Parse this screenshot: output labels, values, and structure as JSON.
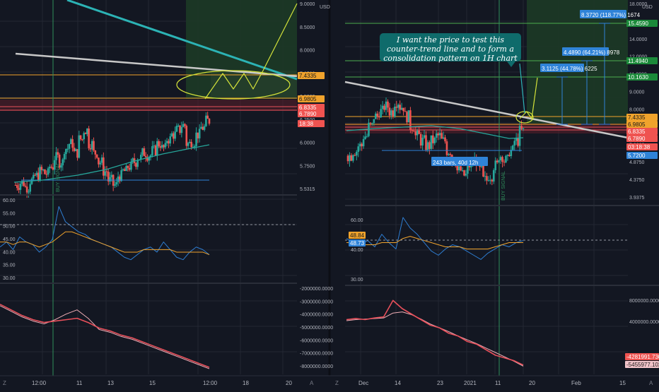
{
  "colors": {
    "bg": "#131722",
    "grid": "#232733",
    "axis_text": "#b2b5be",
    "separator": "#2a2e39",
    "up": "#26a69a",
    "down": "#ef5350",
    "orange": "#f0a32c",
    "green_line": "#4caf50",
    "trend_grey": "#c8c8c8",
    "teal_trend": "#2cb3b5",
    "yellow": "#d4e33a",
    "rsi_blue": "#2e7dd1",
    "ma": "#f0a32c",
    "red_line": "#e8505b",
    "pink": "#f1aeb6",
    "label_blue": "#2f83d8",
    "label_green_bg": "#1b8a3a"
  },
  "left": {
    "price_axis": {
      "ticks": [
        "9.0000",
        "8.5000",
        "8.0000",
        "7.2500",
        "6.5000",
        "6.2500",
        "6.0000",
        "5.7500",
        "5.5315"
      ],
      "currency": "USD"
    },
    "price_labels": [
      {
        "text": "7.4335",
        "style": "orange"
      },
      {
        "text": "6.9805",
        "style": "orange"
      },
      {
        "text": "6.8335",
        "style": "red"
      },
      {
        "text": "6.7890",
        "style": "red"
      },
      {
        "text": "18:38",
        "style": "red"
      }
    ],
    "rsi_axis": [
      "60.00",
      "55.00",
      "50.00",
      "45.00",
      "40.00",
      "35.00",
      "30.00"
    ],
    "obv_axis": [
      "-2000000.0000",
      "-3000000.0000",
      "-4000000.0000",
      "-5000000.0000",
      "-6000000.0000",
      "-7000000.0000",
      "-8000000.0000"
    ],
    "time_axis": [
      "12:00",
      "11",
      "13",
      "15",
      "12:00",
      "18",
      "20"
    ],
    "vertical_label": "BUY SIGNAL"
  },
  "right": {
    "price_axis": {
      "ticks": [
        "18.0000",
        "16.0000",
        "14.0000",
        "12.0000",
        "11.0000",
        "9.0000",
        "8.0000",
        "7.0000",
        "5.8000",
        "4.8750",
        "4.3750",
        "3.9375"
      ],
      "currency": "USD"
    },
    "price_labels": [
      {
        "text": "15.4590",
        "style": "green"
      },
      {
        "text": "11.4940",
        "style": "green"
      },
      {
        "text": "10.1630",
        "style": "green"
      },
      {
        "text": "7.4335",
        "style": "orange"
      },
      {
        "text": "6.9805",
        "style": "orange"
      },
      {
        "text": "6.8335",
        "style": "red"
      },
      {
        "text": "6.7890",
        "style": "red"
      },
      {
        "text": "03:18:38",
        "style": "red"
      },
      {
        "text": "5.7200",
        "style": "blue"
      }
    ],
    "annotation": "I want the price to test this counter-trend line and to form a consolidation pattern on 1H chart",
    "measure_labels": [
      "8.3720 (118.77%) 1674",
      "4.4890 (64.21%) 8978",
      "3.1125 (44.78%) 6225"
    ],
    "range_label": "243 bars, 40d 12h",
    "rsi_axis": [
      "60.00",
      "40.00",
      "30.00"
    ],
    "rsi_labels": [
      "48.84",
      "48.73"
    ],
    "obv_axis": [
      "8000000.0000",
      "4000000.0000"
    ],
    "obv_labels": [
      "-4281991.7301",
      "-5455977.1028"
    ],
    "time_axis": [
      "Dec",
      "14",
      "23",
      "2021",
      "11",
      "20",
      "Feb",
      "15"
    ],
    "vertical_label": "BUY SIGNAL"
  },
  "corner_icons": {
    "timezone": "Z",
    "auto": "A"
  },
  "chart_data": [
    {
      "type": "line",
      "title": "",
      "panel": "left-price",
      "levels": [
        7.4335,
        6.9805,
        6.8335,
        6.789
      ],
      "candles_close": [
        5.6,
        5.65,
        5.55,
        5.7,
        5.8,
        5.9,
        5.85,
        6.0,
        6.2,
        6.1,
        6.4,
        6.5,
        6.3,
        6.6,
        6.8,
        6.5,
        6.3,
        6.1,
        5.9,
        5.7,
        5.6,
        5.8,
        5.9,
        6.0,
        6.1,
        6.2,
        6.3,
        6.25,
        6.35,
        6.5,
        6.4,
        6.6,
        6.7,
        6.8,
        6.9,
        6.5,
        6.55,
        6.7,
        6.85,
        7.0
      ]
    },
    {
      "type": "line",
      "title": "",
      "panel": "left-rsi",
      "series": [
        {
          "values": [
            42,
            44,
            41,
            46,
            44,
            43,
            40,
            42,
            45,
            58,
            52,
            50,
            48,
            47,
            45,
            44,
            43,
            42,
            40,
            38,
            37,
            39,
            41,
            42,
            40,
            44,
            41,
            38,
            37,
            40,
            42,
            41,
            39
          ]
        },
        {
          "values": [
            44,
            44,
            43,
            44,
            44,
            43,
            42,
            43,
            44,
            46,
            48,
            48,
            47,
            46,
            45,
            44,
            43,
            42,
            41,
            40,
            40,
            40,
            41,
            41,
            41,
            41,
            41,
            40,
            40,
            40,
            40,
            40,
            39
          ]
        }
      ],
      "ylim": [
        28,
        62
      ],
      "reference_line": 50
    },
    {
      "type": "line",
      "title": "",
      "panel": "left-obv",
      "series": [
        {
          "values": [
            -3.2,
            -3.6,
            -4.0,
            -4.3,
            -4.5,
            -4.4,
            -4.3,
            -4.2,
            -4.5,
            -4.9,
            -5.1,
            -5.4,
            -5.6,
            -5.9,
            -6.2,
            -6.5,
            -6.8,
            -7.1,
            -7.4,
            -7.7
          ]
        },
        {
          "values": [
            -3.3,
            -3.7,
            -4.1,
            -4.4,
            -4.6,
            -4.3,
            -3.9,
            -3.6,
            -4.2,
            -5.0,
            -5.2,
            -5.5,
            -5.7,
            -6.0,
            -6.3,
            -6.6,
            -6.9,
            -7.2,
            -7.5,
            -7.8
          ]
        }
      ],
      "ylim": [
        -8.2,
        -1.8
      ]
    },
    {
      "type": "line",
      "title": "",
      "panel": "right-price",
      "levels": [
        15.459,
        11.494,
        10.163,
        7.4335,
        6.9805,
        6.8335,
        6.789
      ],
      "measurements": [
        {
          "change": 8.372,
          "percent": 118.77
        },
        {
          "change": 4.489,
          "percent": 64.21
        },
        {
          "change": 3.1125,
          "percent": 44.78
        }
      ]
    },
    {
      "type": "line",
      "title": "",
      "panel": "right-rsi",
      "series": [
        {
          "values": [
            50,
            48,
            47,
            49,
            46,
            52,
            48,
            45,
            60,
            55,
            52,
            48,
            44,
            42,
            45,
            47,
            46,
            44,
            42,
            40,
            43,
            45,
            47,
            46,
            48,
            49
          ]
        },
        {
          "values": [
            48,
            48,
            47,
            47,
            47,
            48,
            48,
            48,
            50,
            51,
            50,
            49,
            48,
            47,
            46,
            46,
            46,
            45,
            45,
            45,
            45,
            46,
            47,
            48,
            48,
            48
          ]
        }
      ],
      "ylim": [
        28,
        65
      ],
      "reference_line": 48.84
    },
    {
      "type": "line",
      "title": "",
      "panel": "right-obv",
      "series": [
        {
          "values": [
            4.0,
            4.2,
            4.0,
            4.3,
            4.5,
            7.5,
            6.0,
            5.0,
            4.0,
            3.0,
            2.5,
            1.5,
            1.0,
            0.0,
            -0.5,
            -1.5,
            -2.5,
            -3.0,
            -3.5,
            -4.3
          ]
        },
        {
          "values": [
            3.8,
            4.0,
            4.1,
            4.2,
            4.3,
            5.2,
            5.4,
            4.9,
            4.1,
            3.2,
            2.5,
            1.8,
            1.0,
            0.3,
            -0.4,
            -1.2,
            -2.0,
            -2.8,
            -3.6,
            -4.5
          ]
        }
      ],
      "ylim": [
        -6,
        10
      ]
    }
  ]
}
